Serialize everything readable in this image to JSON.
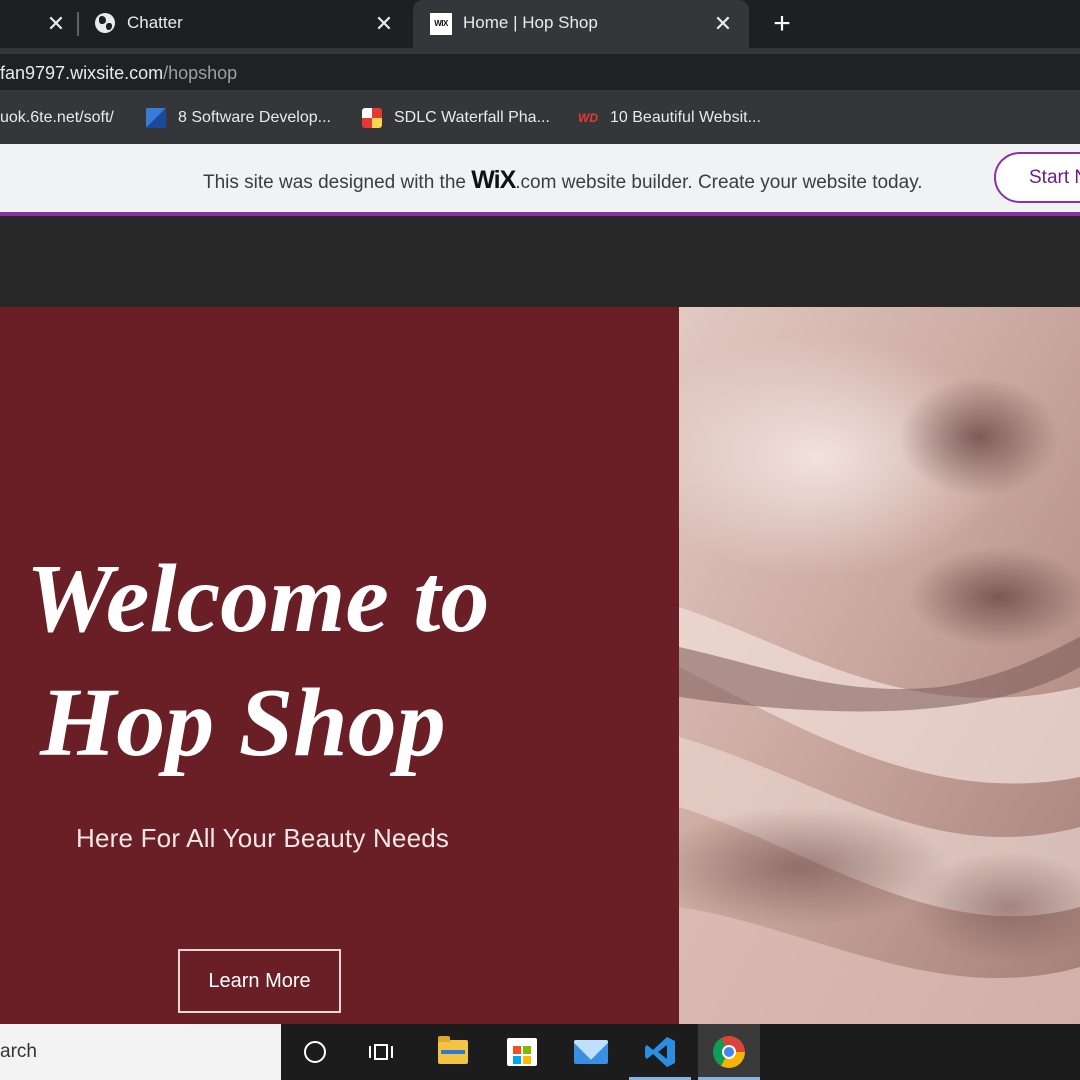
{
  "browser": {
    "tabs": [
      {
        "title": "",
        "active": false
      },
      {
        "title": "Chatter",
        "favicon": "globe-icon",
        "active": false
      },
      {
        "title": "Home | Hop Shop",
        "favicon": "wix-icon",
        "active": true
      }
    ],
    "wix_favicon_text": "WIX",
    "new_tab_symbol": "+",
    "close_symbol": "✕",
    "url_host": "fan9797.wixsite.com",
    "url_path": "/hopshop",
    "bookmarks": [
      {
        "label": "uok.6te.net/soft/",
        "icon": "none"
      },
      {
        "label": "8 Software Develop...",
        "icon": "blue-doc-icon"
      },
      {
        "label": "SDLC Waterfall Pha...",
        "icon": "sdlc-icon"
      },
      {
        "label": "10 Beautiful Websit...",
        "icon": "wd-icon"
      }
    ],
    "wd_icon_text": "WD"
  },
  "wix_banner": {
    "text_before": "This site was designed with the ",
    "logo": "WiX",
    "logo_suffix": ".com",
    "text_after": " website builder. Create your website today.",
    "button": "Start Now",
    "accent_color": "#8e2fa6"
  },
  "hero": {
    "title_line1": "Welcome to",
    "title_line2": "Hop Shop",
    "subtitle": "Here For All Your Beauty Needs",
    "button": "Learn More",
    "background_color": "#6a1e25",
    "image": "pink-silk-fabric"
  },
  "taskbar": {
    "search_text": "arch",
    "apps": [
      "cortana-icon",
      "task-view-icon",
      "file-explorer-icon",
      "store-icon",
      "mail-icon",
      "vscode-icon",
      "chrome-icon"
    ]
  }
}
